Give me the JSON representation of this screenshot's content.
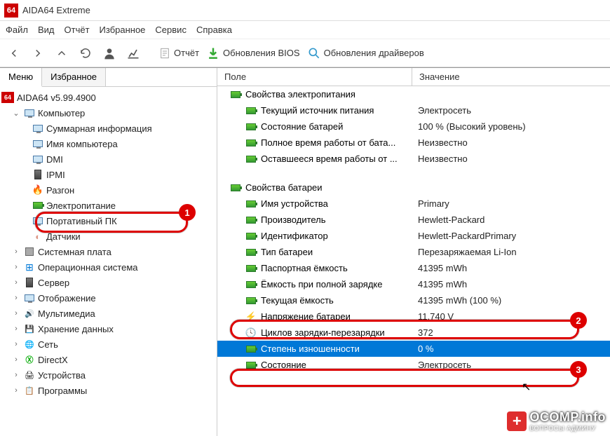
{
  "window": {
    "title": "AIDA64 Extreme"
  },
  "menubar": [
    "Файл",
    "Вид",
    "Отчёт",
    "Избранное",
    "Сервис",
    "Справка"
  ],
  "toolbar": {
    "report": "Отчёт",
    "bios": "Обновления BIOS",
    "drivers": "Обновления драйверов"
  },
  "left_tabs": {
    "menu": "Меню",
    "favorites": "Избранное"
  },
  "tree": {
    "root": "AIDA64 v5.99.4900",
    "computer": "Компьютер",
    "computer_children": [
      "Суммарная информация",
      "Имя компьютера",
      "DMI",
      "IPMI",
      "Разгон",
      "Электропитание",
      "Портативный ПК",
      "Датчики"
    ],
    "others": [
      "Системная плата",
      "Операционная система",
      "Сервер",
      "Отображение",
      "Мультимедиа",
      "Хранение данных",
      "Сеть",
      "DirectX",
      "Устройства",
      "Программы"
    ]
  },
  "right_header": {
    "field": "Поле",
    "value": "Значение"
  },
  "groups": {
    "power_props": "Свойства электропитания",
    "power_rows": [
      {
        "f": "Текущий источник питания",
        "v": "Электросеть"
      },
      {
        "f": "Состояние батарей",
        "v": "100 % (Высокий уровень)"
      },
      {
        "f": "Полное время работы от бата...",
        "v": "Неизвестно"
      },
      {
        "f": "Оставшееся время работы от ...",
        "v": "Неизвестно"
      }
    ],
    "battery_props": "Свойства батареи",
    "battery_rows": [
      {
        "f": "Имя устройства",
        "v": "Primary"
      },
      {
        "f": "Производитель",
        "v": "Hewlett-Packard"
      },
      {
        "f": "Идентификатор",
        "v": "Hewlett-PackardPrimary"
      },
      {
        "f": "Тип батареи",
        "v": "Перезаряжаемая Li-Ion"
      },
      {
        "f": "Паспортная ёмкость",
        "v": "41395 mWh"
      },
      {
        "f": "Ёмкость при полной зарядке",
        "v": "41395 mWh"
      },
      {
        "f": "Текущая ёмкость",
        "v": "41395 mWh  (100 %)"
      },
      {
        "f": "Напряжение батареи",
        "v": "11.740 V",
        "icon": "bolt"
      },
      {
        "f": "Циклов зарядки-перезарядки",
        "v": "372",
        "icon": "clock"
      },
      {
        "f": "Степень изношенности",
        "v": "0 %",
        "selected": true
      },
      {
        "f": "Состояние",
        "v": "Электросеть"
      }
    ]
  },
  "annotations": {
    "n1": "1",
    "n2": "2",
    "n3": "3"
  },
  "watermark": {
    "big": "OCOMP.info",
    "small": "ВОПРОСЫ АДМИНУ"
  }
}
